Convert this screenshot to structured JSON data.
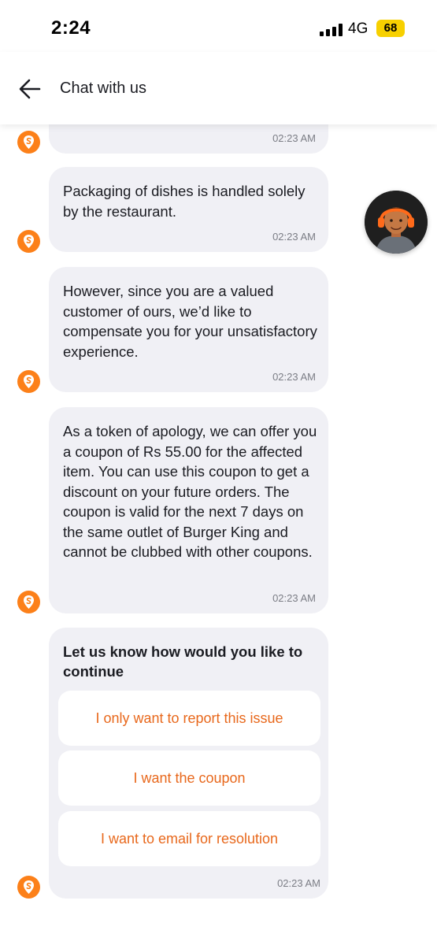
{
  "status_bar": {
    "time": "2:24",
    "network": "4G",
    "battery": "68"
  },
  "header": {
    "title": "Chat with us"
  },
  "messages": [
    {
      "text": "",
      "time": "02:23 AM"
    },
    {
      "text": "Packaging of dishes is handled solely by the restaurant.",
      "time": "02:23 AM"
    },
    {
      "text": "However, since you are a valued customer of ours, we’d like to compensate you for your unsatisfactory experience.",
      "time": "02:23 AM"
    },
    {
      "text": "As a token of apology, we can offer you a coupon of Rs 55.00 for the affected item. You can use this coupon to get a discount on your future orders. The coupon is valid for the next 7 days on the same outlet of Burger King and cannot be clubbed with other coupons.",
      "time": "02:23 AM"
    }
  ],
  "options_card": {
    "title": "Let us know how would you like to continue",
    "options": [
      "I only want to report this issue",
      "I want the coupon",
      "I want to email for resolution"
    ],
    "time": "02:23 AM"
  },
  "colors": {
    "brand": "#fc8019",
    "option_text": "#e8681c",
    "bubble_bg": "#f0f0f5",
    "battery": "#f7d000"
  },
  "icons": {
    "back": "arrow-left-icon",
    "bot": "swiggy-logo-icon",
    "signal": "signal-bars-icon",
    "agent": "support-agent-avatar"
  }
}
